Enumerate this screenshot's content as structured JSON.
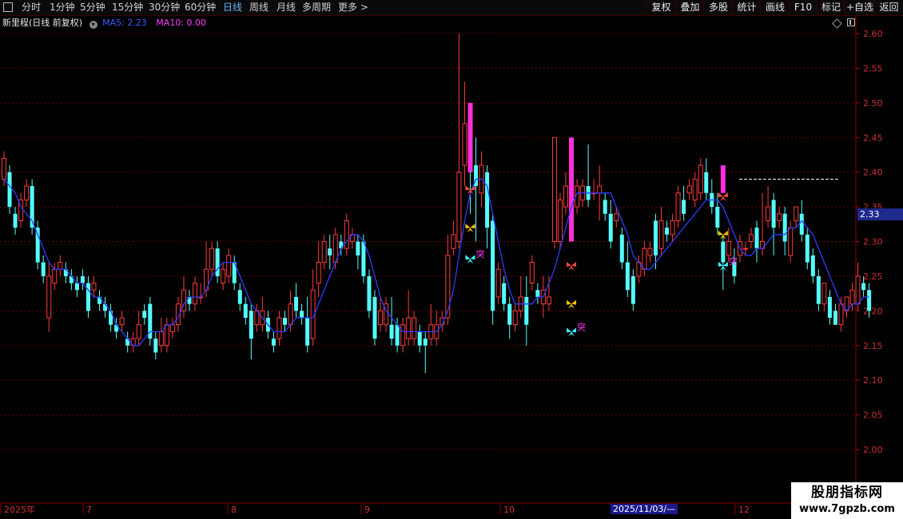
{
  "toolbar": {
    "periods": [
      {
        "label": "分时",
        "active": false
      },
      {
        "label": "1分钟",
        "active": false
      },
      {
        "label": "5分钟",
        "active": false
      },
      {
        "label": "15分钟",
        "active": false
      },
      {
        "label": "30分钟",
        "active": false
      },
      {
        "label": "60分钟",
        "active": false
      },
      {
        "label": "日线",
        "active": true
      },
      {
        "label": "周线",
        "active": false
      },
      {
        "label": "月线",
        "active": false
      },
      {
        "label": "多周期",
        "active": false
      },
      {
        "label": "更多",
        "active": false
      }
    ],
    "more_arrow": ">",
    "buttons": [
      "复权",
      "叠加",
      "多股",
      "统计",
      "画线",
      "F10",
      "标记",
      "+自选",
      "返回"
    ]
  },
  "info": {
    "title": "新里程(日线 前复权)",
    "ma5_label": "MA5: 2.23",
    "ma10_label": "MA10: 0.00"
  },
  "colors": {
    "up": "#ff3b3b",
    "down": "#54ffff",
    "ma5": "#2c3cff",
    "ma10_label": "#ff3bff",
    "grid": "#6a0000",
    "magenta_bar": "#ff2fdc"
  },
  "chart_data": {
    "type": "candlestick",
    "y_ticks": [
      "2.60",
      "2.55",
      "2.50",
      "2.45",
      "2.40",
      "2.35",
      "2.30",
      "2.25",
      "2.20",
      "2.15",
      "2.10",
      "2.05",
      "2.00"
    ],
    "ylim": [
      1.97,
      2.62
    ],
    "x_labels": [
      "2025年",
      "7",
      "8",
      "9",
      "10",
      "12"
    ],
    "cursor_date": "2025/11/03/—",
    "last_price": "2.33",
    "resistance_line": 2.39,
    "annotation_text": "突",
    "candles": [
      [
        2.39,
        2.42,
        2.43,
        2.38
      ],
      [
        2.4,
        2.35,
        2.41,
        2.34
      ],
      [
        2.34,
        2.32,
        2.35,
        2.31
      ],
      [
        2.33,
        2.36,
        2.37,
        2.32
      ],
      [
        2.36,
        2.38,
        2.39,
        2.35
      ],
      [
        2.38,
        2.32,
        2.39,
        2.31
      ],
      [
        2.32,
        2.27,
        2.33,
        2.26
      ],
      [
        2.27,
        2.25,
        2.28,
        2.24
      ],
      [
        2.19,
        2.25,
        2.27,
        2.17
      ],
      [
        2.24,
        2.26,
        2.27,
        2.23
      ],
      [
        2.26,
        2.27,
        2.28,
        2.25
      ],
      [
        2.26,
        2.25,
        2.27,
        2.24
      ],
      [
        2.25,
        2.24,
        2.26,
        2.23
      ],
      [
        2.24,
        2.23,
        2.25,
        2.22
      ],
      [
        2.25,
        2.24,
        2.26,
        2.23
      ],
      [
        2.24,
        2.2,
        2.25,
        2.19
      ],
      [
        2.23,
        2.24,
        2.25,
        2.22
      ],
      [
        2.22,
        2.21,
        2.23,
        2.2
      ],
      [
        2.21,
        2.2,
        2.22,
        2.19
      ],
      [
        2.2,
        2.18,
        2.21,
        2.17
      ],
      [
        2.18,
        2.17,
        2.19,
        2.16
      ],
      [
        2.18,
        2.19,
        2.2,
        2.17
      ],
      [
        2.16,
        2.15,
        2.17,
        2.14
      ],
      [
        2.15,
        2.16,
        2.17,
        2.14
      ],
      [
        2.16,
        2.18,
        2.2,
        2.15
      ],
      [
        2.2,
        2.19,
        2.21,
        2.18
      ],
      [
        2.21,
        2.16,
        2.22,
        2.15
      ],
      [
        2.16,
        2.14,
        2.17,
        2.13
      ],
      [
        2.15,
        2.17,
        2.19,
        2.14
      ],
      [
        2.15,
        2.18,
        2.19,
        2.14
      ],
      [
        2.17,
        2.18,
        2.19,
        2.16
      ],
      [
        2.18,
        2.21,
        2.22,
        2.17
      ],
      [
        2.2,
        2.23,
        2.25,
        2.19
      ],
      [
        2.22,
        2.21,
        2.23,
        2.2
      ],
      [
        2.21,
        2.24,
        2.25,
        2.2
      ],
      [
        2.22,
        2.22,
        2.24,
        2.21
      ],
      [
        2.23,
        2.26,
        2.3,
        2.22
      ],
      [
        2.26,
        2.29,
        2.3,
        2.25
      ],
      [
        2.29,
        2.25,
        2.3,
        2.24
      ],
      [
        2.24,
        2.26,
        2.27,
        2.23
      ],
      [
        2.25,
        2.28,
        2.29,
        2.24
      ],
      [
        2.27,
        2.24,
        2.28,
        2.23
      ],
      [
        2.23,
        2.21,
        2.24,
        2.2
      ],
      [
        2.21,
        2.19,
        2.22,
        2.18
      ],
      [
        2.2,
        2.16,
        2.21,
        2.13
      ],
      [
        2.18,
        2.2,
        2.21,
        2.17
      ],
      [
        2.18,
        2.2,
        2.22,
        2.17
      ],
      [
        2.19,
        2.17,
        2.2,
        2.16
      ],
      [
        2.16,
        2.15,
        2.17,
        2.14
      ],
      [
        2.16,
        2.19,
        2.2,
        2.15
      ],
      [
        2.19,
        2.18,
        2.2,
        2.17
      ],
      [
        2.18,
        2.21,
        2.23,
        2.17
      ],
      [
        2.22,
        2.2,
        2.24,
        2.19
      ],
      [
        2.2,
        2.19,
        2.21,
        2.18
      ],
      [
        2.19,
        2.15,
        2.22,
        2.14
      ],
      [
        2.16,
        2.23,
        2.26,
        2.15
      ],
      [
        2.24,
        2.27,
        2.3,
        2.22
      ],
      [
        2.27,
        2.3,
        2.31,
        2.26
      ],
      [
        2.29,
        2.28,
        2.31,
        2.26
      ],
      [
        2.27,
        2.31,
        2.32,
        2.26
      ],
      [
        2.3,
        2.29,
        2.31,
        2.28
      ],
      [
        2.29,
        2.33,
        2.34,
        2.28
      ],
      [
        2.3,
        2.31,
        2.32,
        2.29
      ],
      [
        2.3,
        2.28,
        2.31,
        2.26
      ],
      [
        2.3,
        2.25,
        2.31,
        2.24
      ],
      [
        2.25,
        2.2,
        2.26,
        2.19
      ],
      [
        2.22,
        2.16,
        2.23,
        2.15
      ],
      [
        2.18,
        2.2,
        2.22,
        2.17
      ],
      [
        2.18,
        2.21,
        2.22,
        2.17
      ],
      [
        2.18,
        2.16,
        2.22,
        2.15
      ],
      [
        2.18,
        2.15,
        2.19,
        2.14
      ],
      [
        2.15,
        2.18,
        2.19,
        2.14
      ],
      [
        2.16,
        2.19,
        2.23,
        2.15
      ],
      [
        2.16,
        2.19,
        2.2,
        2.15
      ],
      [
        2.17,
        2.15,
        2.18,
        2.14
      ],
      [
        2.16,
        2.15,
        2.17,
        2.11
      ],
      [
        2.16,
        2.18,
        2.21,
        2.15
      ],
      [
        2.16,
        2.18,
        2.2,
        2.15
      ],
      [
        2.18,
        2.19,
        2.2,
        2.17
      ],
      [
        2.19,
        2.28,
        2.31,
        2.18
      ],
      [
        2.29,
        2.31,
        2.33,
        2.28
      ],
      [
        2.3,
        2.4,
        2.6,
        2.29
      ],
      [
        2.41,
        2.47,
        2.53,
        2.38
      ],
      [
        2.47,
        2.4,
        2.48,
        2.34
      ],
      [
        2.41,
        2.38,
        2.45,
        2.3
      ],
      [
        2.37,
        2.41,
        2.43,
        2.35
      ],
      [
        2.4,
        2.32,
        2.41,
        2.29
      ],
      [
        2.33,
        2.2,
        2.34,
        2.18
      ],
      [
        2.22,
        2.26,
        2.27,
        2.21
      ],
      [
        2.24,
        2.21,
        2.25,
        2.2
      ],
      [
        2.21,
        2.18,
        2.22,
        2.16
      ],
      [
        2.18,
        2.2,
        2.21,
        2.17
      ],
      [
        2.2,
        2.22,
        2.25,
        2.19
      ],
      [
        2.22,
        2.18,
        2.25,
        2.15
      ],
      [
        2.24,
        2.27,
        2.28,
        2.23
      ],
      [
        2.23,
        2.22,
        2.24,
        2.21
      ],
      [
        2.21,
        2.23,
        2.25,
        2.19
      ],
      [
        2.21,
        2.22,
        2.25,
        2.2
      ],
      [
        2.3,
        2.45,
        2.45,
        2.29
      ],
      [
        2.3,
        2.36,
        2.37,
        2.29
      ],
      [
        2.35,
        2.38,
        2.4,
        2.34
      ],
      [
        2.41,
        2.34,
        2.42,
        2.33
      ],
      [
        2.35,
        2.38,
        2.39,
        2.34
      ],
      [
        2.36,
        2.38,
        2.39,
        2.35
      ],
      [
        2.38,
        2.36,
        2.44,
        2.35
      ],
      [
        2.37,
        2.37,
        2.39,
        2.36
      ],
      [
        2.37,
        2.38,
        2.41,
        2.33
      ],
      [
        2.36,
        2.34,
        2.37,
        2.33
      ],
      [
        2.34,
        2.3,
        2.36,
        2.29
      ],
      [
        2.33,
        2.34,
        2.35,
        2.32
      ],
      [
        2.31,
        2.27,
        2.32,
        2.26
      ],
      [
        2.27,
        2.23,
        2.3,
        2.22
      ],
      [
        2.25,
        2.21,
        2.26,
        2.2
      ],
      [
        2.25,
        2.27,
        2.28,
        2.24
      ],
      [
        2.26,
        2.29,
        2.3,
        2.25
      ],
      [
        2.28,
        2.29,
        2.3,
        2.27
      ],
      [
        2.33,
        2.28,
        2.34,
        2.26
      ],
      [
        2.29,
        2.33,
        2.35,
        2.28
      ],
      [
        2.32,
        2.31,
        2.33,
        2.3
      ],
      [
        2.31,
        2.33,
        2.34,
        2.3
      ],
      [
        2.33,
        2.37,
        2.38,
        2.32
      ],
      [
        2.36,
        2.34,
        2.38,
        2.33
      ],
      [
        2.37,
        2.38,
        2.39,
        2.36
      ],
      [
        2.36,
        2.39,
        2.4,
        2.35
      ],
      [
        2.37,
        2.41,
        2.42,
        2.36
      ],
      [
        2.4,
        2.37,
        2.42,
        2.36
      ],
      [
        2.37,
        2.35,
        2.39,
        2.34
      ],
      [
        2.35,
        2.32,
        2.37,
        2.31
      ],
      [
        2.3,
        2.27,
        2.31,
        2.23
      ],
      [
        2.28,
        2.3,
        2.32,
        2.27
      ],
      [
        2.27,
        2.25,
        2.29,
        2.24
      ],
      [
        2.28,
        2.3,
        2.31,
        2.27
      ],
      [
        2.29,
        2.29,
        2.3,
        2.28
      ],
      [
        2.3,
        2.31,
        2.32,
        2.29
      ],
      [
        2.32,
        2.29,
        2.33,
        2.27
      ],
      [
        2.29,
        2.3,
        2.37,
        2.28
      ],
      [
        2.33,
        2.35,
        2.38,
        2.32
      ],
      [
        2.36,
        2.32,
        2.37,
        2.28
      ],
      [
        2.33,
        2.34,
        2.35,
        2.32
      ],
      [
        2.34,
        2.3,
        2.35,
        2.28
      ],
      [
        2.28,
        2.32,
        2.33,
        2.27
      ],
      [
        2.33,
        2.35,
        2.35,
        2.32
      ],
      [
        2.34,
        2.31,
        2.36,
        2.3
      ],
      [
        2.31,
        2.27,
        2.32,
        2.26
      ],
      [
        2.28,
        2.25,
        2.29,
        2.24
      ],
      [
        2.25,
        2.21,
        2.26,
        2.2
      ],
      [
        2.21,
        2.24,
        2.24,
        2.2
      ],
      [
        2.22,
        2.19,
        2.23,
        2.18
      ],
      [
        2.2,
        2.18,
        2.21,
        2.18
      ],
      [
        2.18,
        2.21,
        2.22,
        2.17
      ],
      [
        2.2,
        2.22,
        2.22,
        2.19
      ],
      [
        2.21,
        2.23,
        2.24,
        2.2
      ],
      [
        2.21,
        2.25,
        2.27,
        2.2
      ],
      [
        2.24,
        2.23,
        2.25,
        2.22
      ],
      [
        2.23,
        2.2,
        2.24,
        2.19
      ]
    ],
    "ma5": [
      2.39,
      2.38,
      2.37,
      2.35,
      2.34,
      2.33,
      2.31,
      2.29,
      2.27,
      2.26,
      2.26,
      2.26,
      2.25,
      2.24,
      2.24,
      2.23,
      2.22,
      2.22,
      2.21,
      2.2,
      2.18,
      2.17,
      2.16,
      2.15,
      2.15,
      2.16,
      2.17,
      2.17,
      2.17,
      2.18,
      2.18,
      2.19,
      2.21,
      2.22,
      2.22,
      2.22,
      2.23,
      2.25,
      2.26,
      2.27,
      2.27,
      2.27,
      2.25,
      2.23,
      2.21,
      2.2,
      2.19,
      2.18,
      2.17,
      2.17,
      2.17,
      2.18,
      2.19,
      2.19,
      2.19,
      2.19,
      2.21,
      2.23,
      2.25,
      2.27,
      2.29,
      2.3,
      2.31,
      2.31,
      2.3,
      2.28,
      2.25,
      2.22,
      2.2,
      2.19,
      2.18,
      2.17,
      2.17,
      2.17,
      2.17,
      2.17,
      2.17,
      2.17,
      2.18,
      2.2,
      2.23,
      2.28,
      2.33,
      2.37,
      2.39,
      2.39,
      2.38,
      2.34,
      2.3,
      2.26,
      2.23,
      2.21,
      2.21,
      2.21,
      2.21,
      2.22,
      2.22,
      2.24,
      2.26,
      2.29,
      2.32,
      2.35,
      2.37,
      2.37,
      2.37,
      2.37,
      2.37,
      2.37,
      2.37,
      2.35,
      2.33,
      2.31,
      2.28,
      2.27,
      2.26,
      2.26,
      2.27,
      2.28,
      2.29,
      2.3,
      2.31,
      2.32,
      2.33,
      2.34,
      2.35,
      2.36,
      2.36,
      2.36,
      2.35,
      2.33,
      2.31,
      2.29,
      2.28,
      2.28,
      2.29,
      2.29,
      2.3,
      2.31,
      2.31,
      2.31,
      2.32,
      2.32,
      2.33,
      2.32,
      2.31,
      2.29,
      2.27,
      2.25,
      2.23,
      2.21,
      2.2,
      2.21,
      2.21,
      2.22,
      2.22
    ]
  },
  "signals": [
    {
      "index": 83,
      "price": 2.375,
      "type": "red"
    },
    {
      "index": 83,
      "price": 2.32,
      "type": "yellow"
    },
    {
      "index": 83,
      "price": 2.275,
      "type": "cyan",
      "label": "突"
    },
    {
      "index": 101,
      "price": 2.265,
      "type": "red"
    },
    {
      "index": 101,
      "price": 2.21,
      "type": "yellow"
    },
    {
      "index": 101,
      "price": 2.17,
      "type": "cyan",
      "label": "突"
    },
    {
      "index": 128,
      "price": 2.365,
      "type": "red"
    },
    {
      "index": 128,
      "price": 2.31,
      "type": "yellow"
    },
    {
      "index": 128,
      "price": 2.265,
      "type": "cyan",
      "label": "突"
    }
  ],
  "highlight_bars": [
    {
      "index": 83,
      "from": 2.4,
      "to": 2.5
    },
    {
      "index": 101,
      "from": 2.3,
      "to": 2.45
    },
    {
      "index": 128,
      "from": 2.37,
      "to": 2.41
    }
  ],
  "watermark": {
    "title": "股朋指标网",
    "url": "www.7gpzb.com"
  }
}
